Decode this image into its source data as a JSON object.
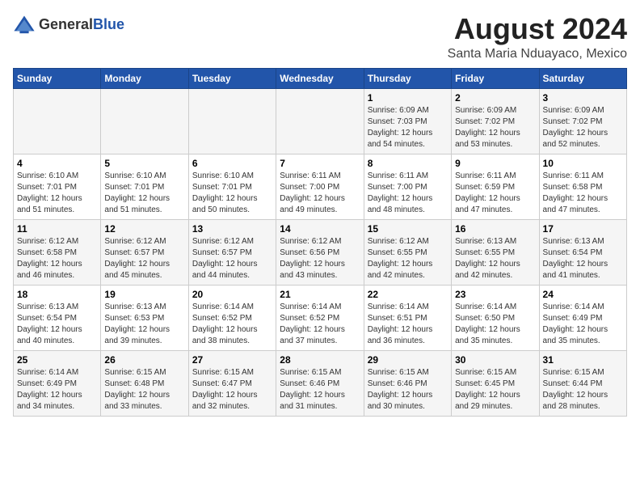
{
  "header": {
    "logo_general": "General",
    "logo_blue": "Blue",
    "main_title": "August 2024",
    "sub_title": "Santa Maria Nduayaco, Mexico"
  },
  "calendar": {
    "days_of_week": [
      "Sunday",
      "Monday",
      "Tuesday",
      "Wednesday",
      "Thursday",
      "Friday",
      "Saturday"
    ],
    "weeks": [
      [
        {
          "day": "",
          "info": ""
        },
        {
          "day": "",
          "info": ""
        },
        {
          "day": "",
          "info": ""
        },
        {
          "day": "",
          "info": ""
        },
        {
          "day": "1",
          "info": "Sunrise: 6:09 AM\nSunset: 7:03 PM\nDaylight: 12 hours\nand 54 minutes."
        },
        {
          "day": "2",
          "info": "Sunrise: 6:09 AM\nSunset: 7:02 PM\nDaylight: 12 hours\nand 53 minutes."
        },
        {
          "day": "3",
          "info": "Sunrise: 6:09 AM\nSunset: 7:02 PM\nDaylight: 12 hours\nand 52 minutes."
        }
      ],
      [
        {
          "day": "4",
          "info": "Sunrise: 6:10 AM\nSunset: 7:01 PM\nDaylight: 12 hours\nand 51 minutes."
        },
        {
          "day": "5",
          "info": "Sunrise: 6:10 AM\nSunset: 7:01 PM\nDaylight: 12 hours\nand 51 minutes."
        },
        {
          "day": "6",
          "info": "Sunrise: 6:10 AM\nSunset: 7:01 PM\nDaylight: 12 hours\nand 50 minutes."
        },
        {
          "day": "7",
          "info": "Sunrise: 6:11 AM\nSunset: 7:00 PM\nDaylight: 12 hours\nand 49 minutes."
        },
        {
          "day": "8",
          "info": "Sunrise: 6:11 AM\nSunset: 7:00 PM\nDaylight: 12 hours\nand 48 minutes."
        },
        {
          "day": "9",
          "info": "Sunrise: 6:11 AM\nSunset: 6:59 PM\nDaylight: 12 hours\nand 47 minutes."
        },
        {
          "day": "10",
          "info": "Sunrise: 6:11 AM\nSunset: 6:58 PM\nDaylight: 12 hours\nand 47 minutes."
        }
      ],
      [
        {
          "day": "11",
          "info": "Sunrise: 6:12 AM\nSunset: 6:58 PM\nDaylight: 12 hours\nand 46 minutes."
        },
        {
          "day": "12",
          "info": "Sunrise: 6:12 AM\nSunset: 6:57 PM\nDaylight: 12 hours\nand 45 minutes."
        },
        {
          "day": "13",
          "info": "Sunrise: 6:12 AM\nSunset: 6:57 PM\nDaylight: 12 hours\nand 44 minutes."
        },
        {
          "day": "14",
          "info": "Sunrise: 6:12 AM\nSunset: 6:56 PM\nDaylight: 12 hours\nand 43 minutes."
        },
        {
          "day": "15",
          "info": "Sunrise: 6:12 AM\nSunset: 6:55 PM\nDaylight: 12 hours\nand 42 minutes."
        },
        {
          "day": "16",
          "info": "Sunrise: 6:13 AM\nSunset: 6:55 PM\nDaylight: 12 hours\nand 42 minutes."
        },
        {
          "day": "17",
          "info": "Sunrise: 6:13 AM\nSunset: 6:54 PM\nDaylight: 12 hours\nand 41 minutes."
        }
      ],
      [
        {
          "day": "18",
          "info": "Sunrise: 6:13 AM\nSunset: 6:54 PM\nDaylight: 12 hours\nand 40 minutes."
        },
        {
          "day": "19",
          "info": "Sunrise: 6:13 AM\nSunset: 6:53 PM\nDaylight: 12 hours\nand 39 minutes."
        },
        {
          "day": "20",
          "info": "Sunrise: 6:14 AM\nSunset: 6:52 PM\nDaylight: 12 hours\nand 38 minutes."
        },
        {
          "day": "21",
          "info": "Sunrise: 6:14 AM\nSunset: 6:52 PM\nDaylight: 12 hours\nand 37 minutes."
        },
        {
          "day": "22",
          "info": "Sunrise: 6:14 AM\nSunset: 6:51 PM\nDaylight: 12 hours\nand 36 minutes."
        },
        {
          "day": "23",
          "info": "Sunrise: 6:14 AM\nSunset: 6:50 PM\nDaylight: 12 hours\nand 35 minutes."
        },
        {
          "day": "24",
          "info": "Sunrise: 6:14 AM\nSunset: 6:49 PM\nDaylight: 12 hours\nand 35 minutes."
        }
      ],
      [
        {
          "day": "25",
          "info": "Sunrise: 6:14 AM\nSunset: 6:49 PM\nDaylight: 12 hours\nand 34 minutes."
        },
        {
          "day": "26",
          "info": "Sunrise: 6:15 AM\nSunset: 6:48 PM\nDaylight: 12 hours\nand 33 minutes."
        },
        {
          "day": "27",
          "info": "Sunrise: 6:15 AM\nSunset: 6:47 PM\nDaylight: 12 hours\nand 32 minutes."
        },
        {
          "day": "28",
          "info": "Sunrise: 6:15 AM\nSunset: 6:46 PM\nDaylight: 12 hours\nand 31 minutes."
        },
        {
          "day": "29",
          "info": "Sunrise: 6:15 AM\nSunset: 6:46 PM\nDaylight: 12 hours\nand 30 minutes."
        },
        {
          "day": "30",
          "info": "Sunrise: 6:15 AM\nSunset: 6:45 PM\nDaylight: 12 hours\nand 29 minutes."
        },
        {
          "day": "31",
          "info": "Sunrise: 6:15 AM\nSunset: 6:44 PM\nDaylight: 12 hours\nand 28 minutes."
        }
      ]
    ]
  }
}
